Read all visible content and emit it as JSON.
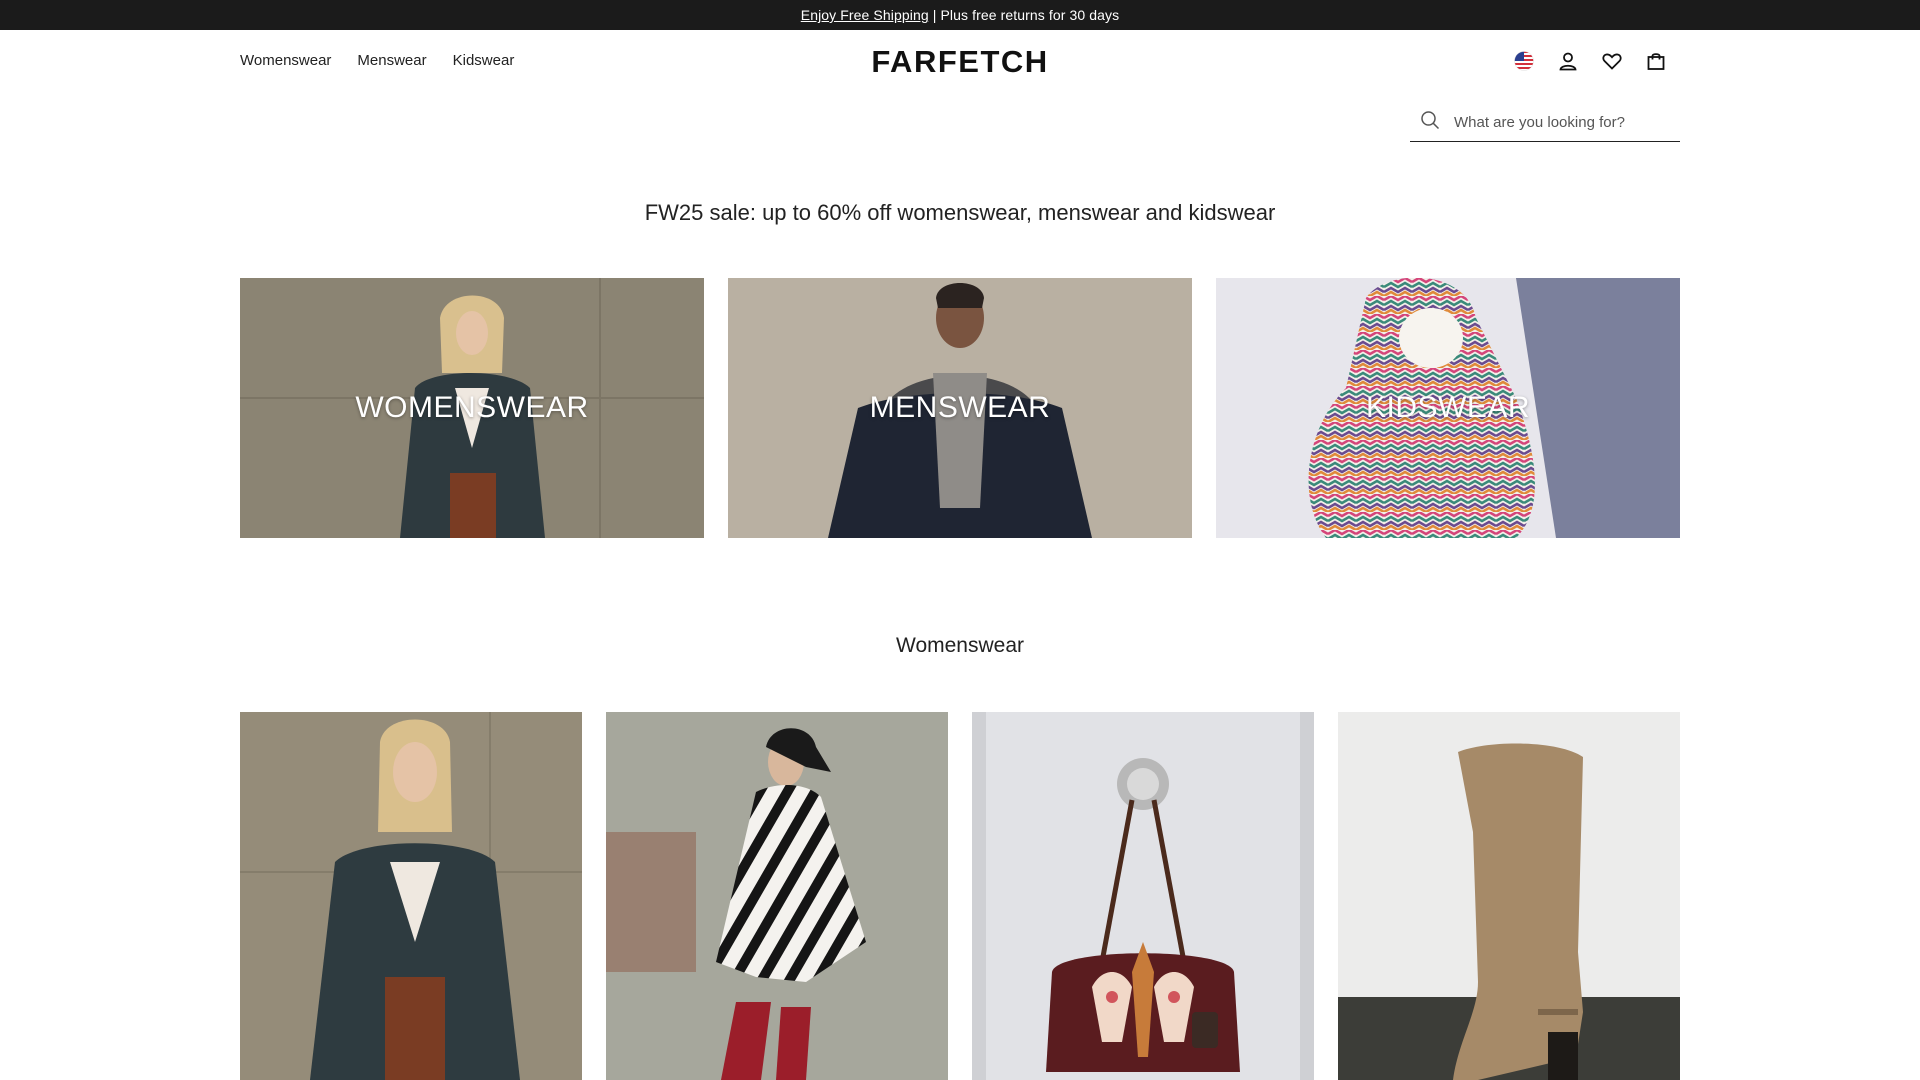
{
  "announcement": {
    "link_text": "Enjoy Free Shipping",
    "text": "| Plus free returns for 30 days"
  },
  "header": {
    "nav": [
      "Womenswear",
      "Menswear",
      "Kidswear"
    ],
    "logo": "FARFETCH",
    "icons": [
      "us-flag-icon",
      "account-icon",
      "wishlist-heart-icon",
      "shopping-bag-icon"
    ]
  },
  "search": {
    "placeholder": "What are you looking for?"
  },
  "headline": "FW25 sale: up to 60% off womenswear, menswear and kidswear",
  "categories": [
    {
      "label": "WOMENSWEAR"
    },
    {
      "label": "MENSWEAR"
    },
    {
      "label": "KIDSWEAR"
    }
  ],
  "section": {
    "title": "Womenswear"
  },
  "colors": {
    "announcement_bg": "#1b1b1b",
    "text": "#222222",
    "background": "#ffffff"
  }
}
